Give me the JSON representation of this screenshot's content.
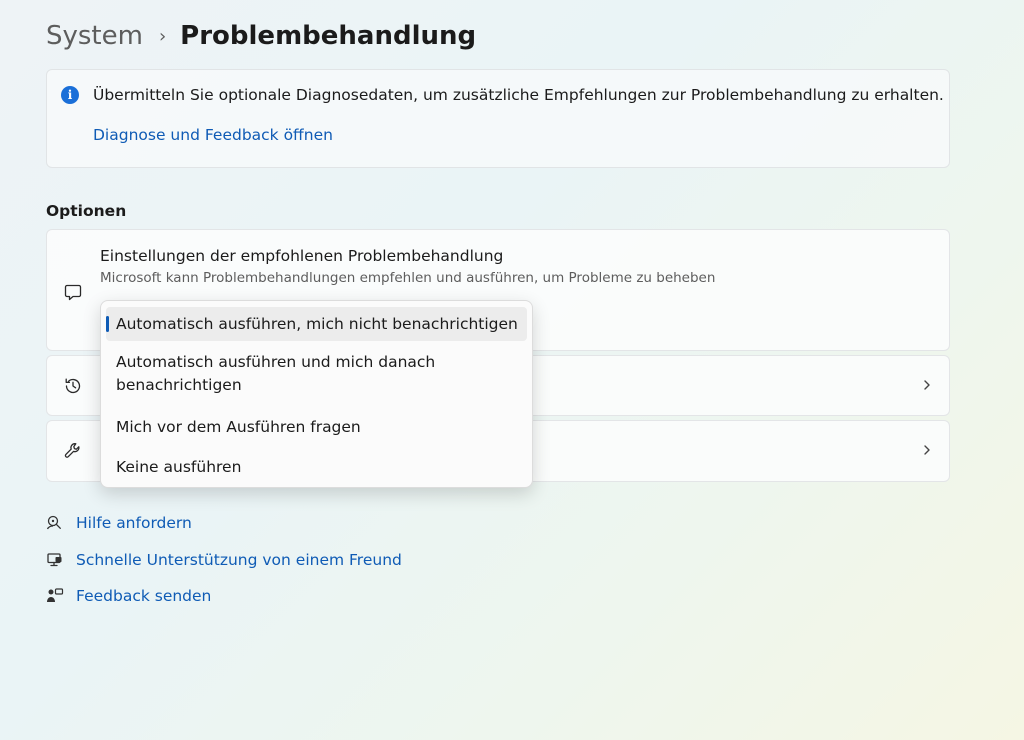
{
  "breadcrumb": {
    "parent": "System",
    "separator": "›",
    "current": "Problembehandlung"
  },
  "info_banner": {
    "icon": "info-icon",
    "text": "Übermitteln Sie optionale Diagnosedaten, um zusätzliche Empfehlungen zur Problembehandlung zu erhalten.",
    "link": "Diagnose und Feedback öffnen"
  },
  "options": {
    "title": "Optionen",
    "recommended": {
      "icon": "chat-bubble-icon",
      "title": "Einstellungen der empfohlenen Problembehandlung",
      "subtitle": "Microsoft kann Problembehandlungen empfehlen und ausführen, um Probleme zu beheben"
    },
    "history": {
      "icon": "history-icon"
    },
    "other": {
      "icon": "wrench-icon"
    }
  },
  "dropdown": {
    "selected_index": 0,
    "options": [
      "Automatisch ausführen, mich nicht benachrichtigen",
      "Automatisch ausführen und mich danach benachrichtigen",
      "Mich vor dem Ausführen fragen",
      "Keine ausführen"
    ]
  },
  "help_links": [
    {
      "icon": "help-icon",
      "label": "Hilfe anfordern"
    },
    {
      "icon": "quick-assist-icon",
      "label": "Schnelle Unterstützung von einem Freund"
    },
    {
      "icon": "feedback-icon",
      "label": "Feedback senden"
    }
  ],
  "colors": {
    "accent": "#0f5bb5",
    "info_icon": "#1a6fd8"
  }
}
